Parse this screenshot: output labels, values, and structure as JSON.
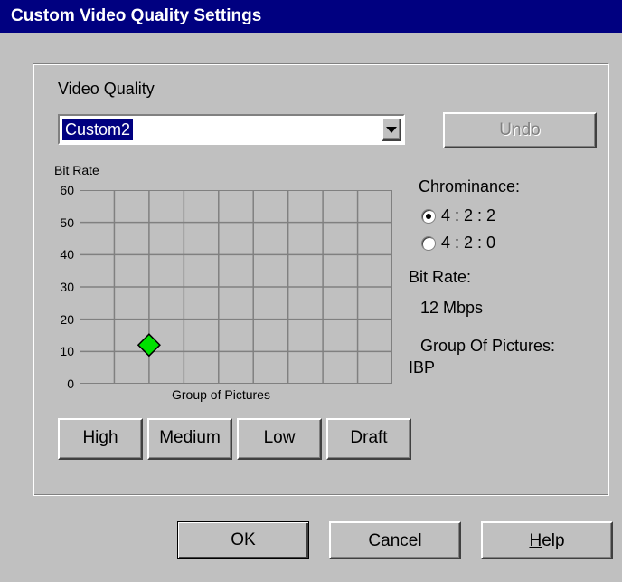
{
  "window": {
    "title": "Custom Video Quality Settings"
  },
  "quality": {
    "label": "Video Quality",
    "selected": "Custom2",
    "undo_label": "Undo"
  },
  "chart_data": {
    "type": "scatter",
    "ylabel": "Bit Rate",
    "xlabel": "Group of Pictures",
    "yticks": [
      "60",
      "50",
      "40",
      "30",
      "20",
      "10",
      "0"
    ],
    "ylim": [
      0,
      60
    ],
    "x_cells": 9,
    "grid": true,
    "points": [
      {
        "x": 2,
        "y": 12,
        "color": "#00e000"
      }
    ]
  },
  "chroma": {
    "label": "Chrominance:",
    "options": [
      {
        "label": "4 : 2 : 2",
        "checked": true
      },
      {
        "label": "4 : 2 : 0",
        "checked": false
      }
    ]
  },
  "info": {
    "bitrate_label": "Bit Rate:",
    "bitrate_value": "12 Mbps",
    "gop_label": "Group Of Pictures:",
    "gop_value": "IBP"
  },
  "presets": [
    "High",
    "Medium",
    "Low",
    "Draft"
  ],
  "footer": {
    "ok": "OK",
    "cancel": "Cancel",
    "help_first": "H",
    "help_rest": "elp"
  }
}
